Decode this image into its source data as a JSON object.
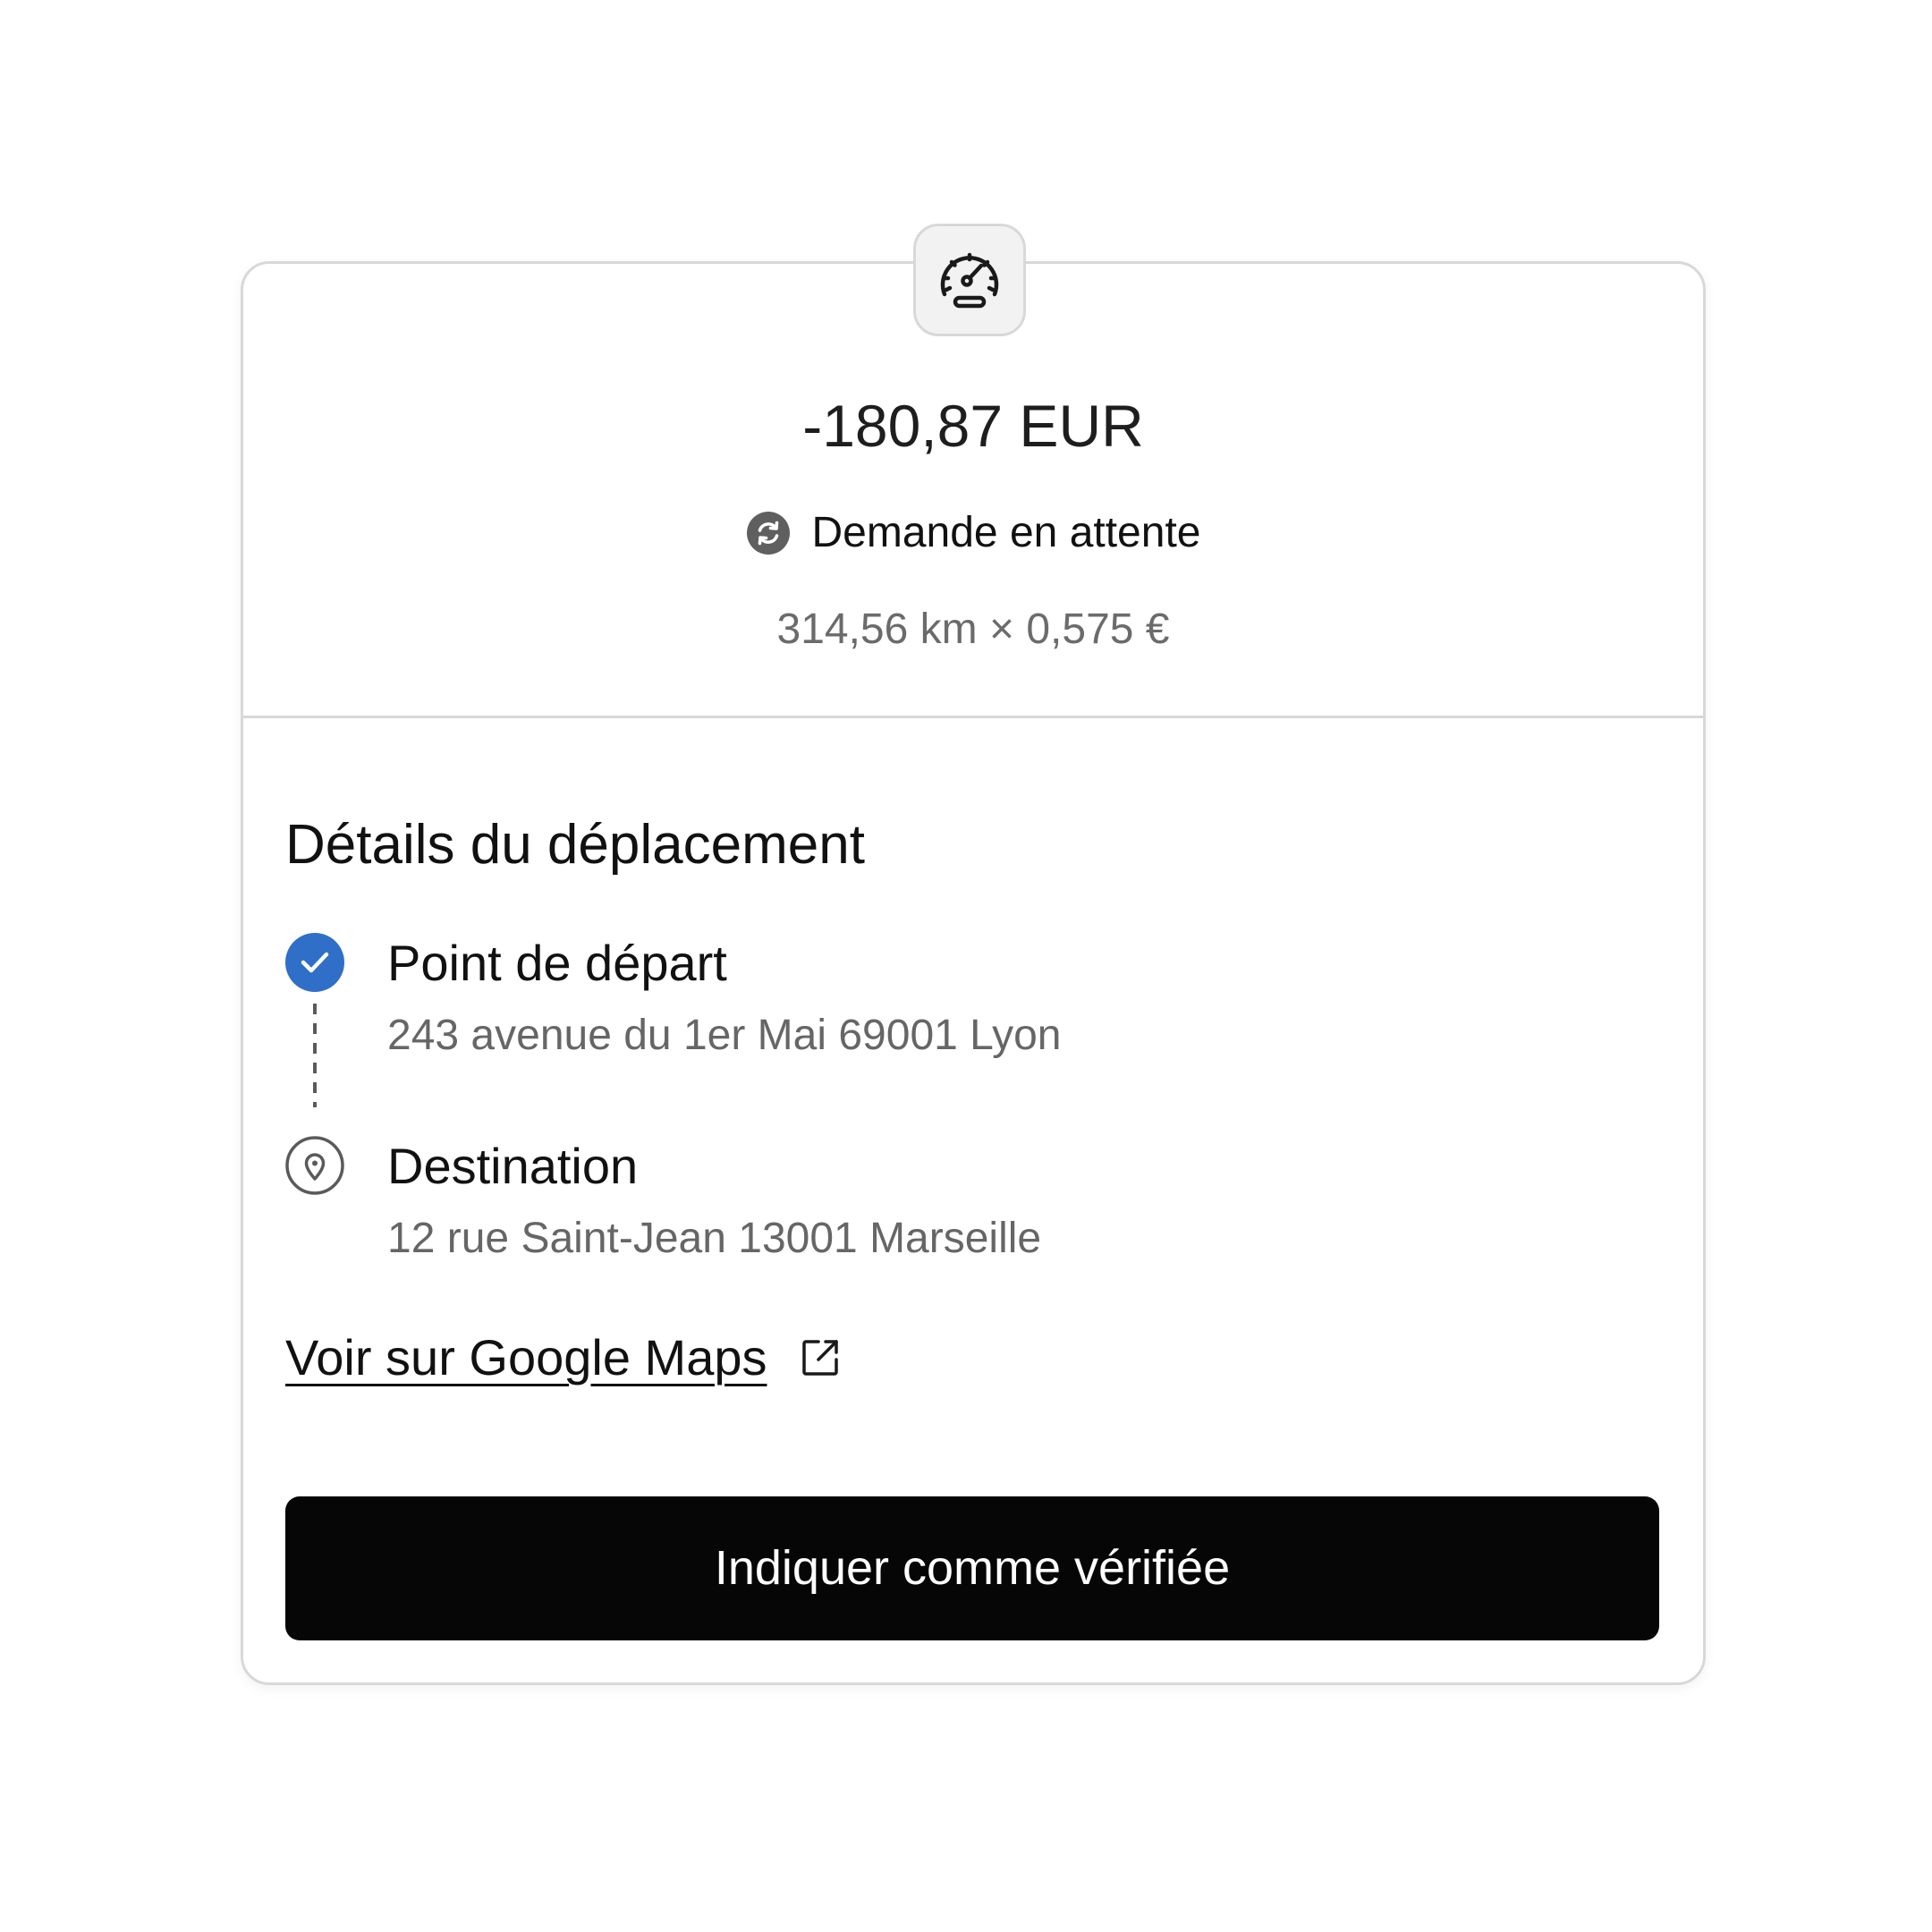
{
  "expense": {
    "icon": "speedometer-icon",
    "amount": "-180,87 EUR",
    "status": {
      "label": "Demande en attente",
      "icon": "sync-pending-icon"
    },
    "calculation": "314,56 km × 0,575 €"
  },
  "trip": {
    "title": "Détails du déplacement",
    "departure": {
      "label": "Point de départ",
      "address": "243 avenue du 1er Mai 69001 Lyon",
      "icon": "check-circle-icon"
    },
    "destination": {
      "label": "Destination",
      "address": "12 rue Saint-Jean 13001 Marseille",
      "icon": "location-pin-icon"
    },
    "maps_link": {
      "label": "Voir sur Google Maps",
      "icon": "external-link-icon"
    }
  },
  "actions": {
    "verify_label": "Indiquer comme vérifiée"
  },
  "colors": {
    "accent": "#2f6fc8",
    "button_bg": "#060606",
    "border": "#d8d8d8",
    "muted_text": "#666666"
  }
}
